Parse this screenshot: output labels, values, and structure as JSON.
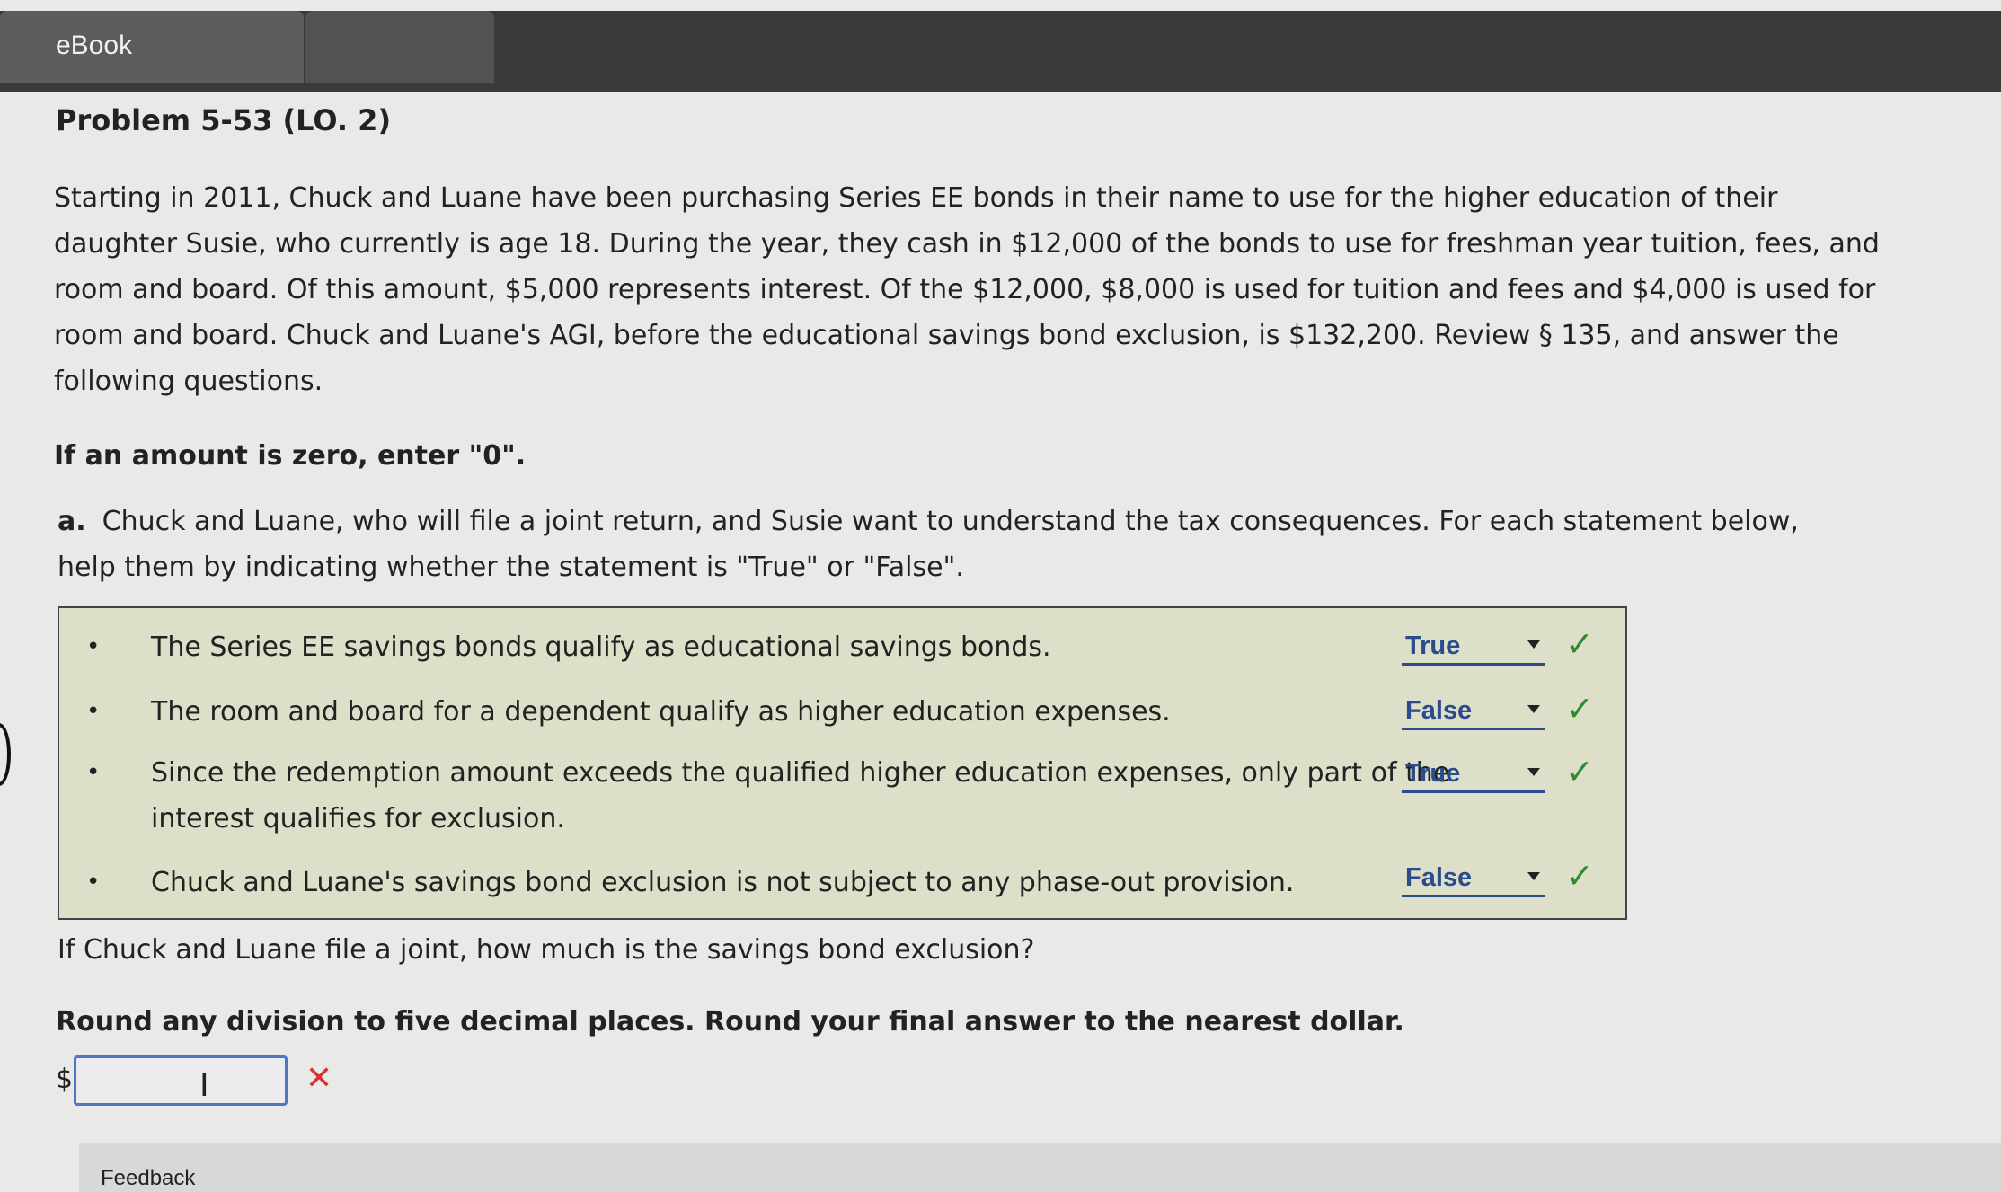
{
  "tabs": [
    {
      "label": "eBook"
    },
    {
      "label": ""
    }
  ],
  "problem": {
    "title": "Problem 5-53 (LO. 2)",
    "intro": "Starting in 2011, Chuck and Luane have been purchasing Series EE bonds in their name to use for the higher education of their daughter Susie, who currently is age 18. During the year, they cash in $12,000 of the bonds to use for freshman year tuition, fees, and room and board. Of this amount, $5,000 represents interest. Of the $12,000, $8,000 is used for tuition and fees and $4,000 is used for room and board. Chuck and Luane's AGI, before the educational savings bond exclusion, is $132,200. Review § 135, and answer the following questions.",
    "zero_note": "If an amount is zero, enter \"0\".",
    "part_a": {
      "letter": "a.",
      "text": "Chuck and Luane, who will file a joint return, and Susie want to understand the tax consequences. For each statement below, help them by indicating whether the statement is \"True\" or \"False\"."
    }
  },
  "statements": [
    {
      "text": "The Series EE savings bonds qualify as educational savings bonds.",
      "selected": "True",
      "status": "correct"
    },
    {
      "text": "The room and board for a dependent qualify as higher education expenses.",
      "selected": "False",
      "status": "correct"
    },
    {
      "text": "Since the redemption amount exceeds the qualified higher education expenses, only part of the interest qualifies for exclusion.",
      "selected": "True",
      "status": "correct"
    },
    {
      "text": "Chuck and Luane's savings bond exclusion is not subject to any phase-out provision.",
      "selected": "False",
      "status": "correct"
    }
  ],
  "question2": {
    "text": "If Chuck and Luane file a joint, how much is the savings bond exclusion?",
    "round_note": "Round any division to five decimal places. Round your final answer to the nearest dollar.",
    "currency": "$",
    "value": "",
    "status": "incorrect"
  },
  "icons": {
    "bullet": "•",
    "check": "✓",
    "wrong": "✕",
    "cursor": "I"
  },
  "colors": {
    "select_text": "#2a4b8c",
    "check": "#2e8b2e",
    "wrong": "#d9322b",
    "statement_bg": "#dedfc9"
  },
  "feedback": {
    "label": "Feedback"
  }
}
